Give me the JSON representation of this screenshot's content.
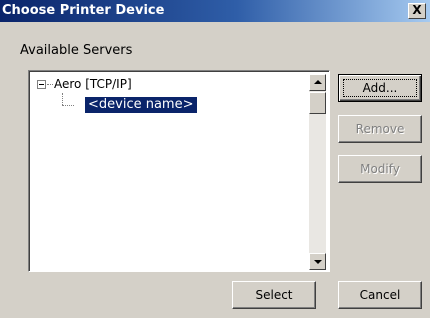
{
  "window": {
    "title": "Choose Printer Device",
    "close_label": "X"
  },
  "servers": {
    "label": "Available Servers",
    "tree": {
      "root": "Aero [TCP/IP]",
      "child": "<device name>"
    }
  },
  "buttons": {
    "add": "Add...",
    "remove": "Remove",
    "modify": "Modify",
    "select": "Select",
    "cancel": "Cancel"
  },
  "colors": {
    "title_start": "#0a246a",
    "title_end": "#a6caf0",
    "selection": "#0a246a",
    "face": "#d4d0c8"
  },
  "icons": [
    "close-icon",
    "collapse-icon",
    "scroll-up-icon",
    "scroll-down-icon"
  ]
}
